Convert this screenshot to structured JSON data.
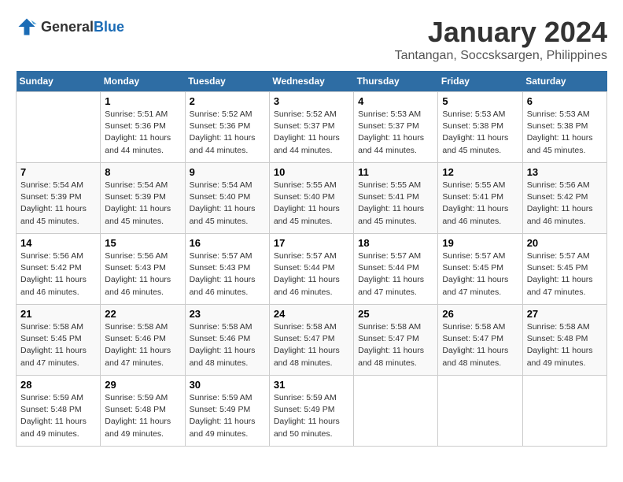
{
  "header": {
    "logo": {
      "general": "General",
      "blue": "Blue"
    },
    "title": "January 2024",
    "subtitle": "Tantangan, Soccsksargen, Philippines"
  },
  "calendar": {
    "days_of_week": [
      "Sunday",
      "Monday",
      "Tuesday",
      "Wednesday",
      "Thursday",
      "Friday",
      "Saturday"
    ],
    "weeks": [
      [
        {
          "day": "",
          "info": ""
        },
        {
          "day": "1",
          "info": "Sunrise: 5:51 AM\nSunset: 5:36 PM\nDaylight: 11 hours\nand 44 minutes."
        },
        {
          "day": "2",
          "info": "Sunrise: 5:52 AM\nSunset: 5:36 PM\nDaylight: 11 hours\nand 44 minutes."
        },
        {
          "day": "3",
          "info": "Sunrise: 5:52 AM\nSunset: 5:37 PM\nDaylight: 11 hours\nand 44 minutes."
        },
        {
          "day": "4",
          "info": "Sunrise: 5:53 AM\nSunset: 5:37 PM\nDaylight: 11 hours\nand 44 minutes."
        },
        {
          "day": "5",
          "info": "Sunrise: 5:53 AM\nSunset: 5:38 PM\nDaylight: 11 hours\nand 45 minutes."
        },
        {
          "day": "6",
          "info": "Sunrise: 5:53 AM\nSunset: 5:38 PM\nDaylight: 11 hours\nand 45 minutes."
        }
      ],
      [
        {
          "day": "7",
          "info": "Sunrise: 5:54 AM\nSunset: 5:39 PM\nDaylight: 11 hours\nand 45 minutes."
        },
        {
          "day": "8",
          "info": "Sunrise: 5:54 AM\nSunset: 5:39 PM\nDaylight: 11 hours\nand 45 minutes."
        },
        {
          "day": "9",
          "info": "Sunrise: 5:54 AM\nSunset: 5:40 PM\nDaylight: 11 hours\nand 45 minutes."
        },
        {
          "day": "10",
          "info": "Sunrise: 5:55 AM\nSunset: 5:40 PM\nDaylight: 11 hours\nand 45 minutes."
        },
        {
          "day": "11",
          "info": "Sunrise: 5:55 AM\nSunset: 5:41 PM\nDaylight: 11 hours\nand 45 minutes."
        },
        {
          "day": "12",
          "info": "Sunrise: 5:55 AM\nSunset: 5:41 PM\nDaylight: 11 hours\nand 46 minutes."
        },
        {
          "day": "13",
          "info": "Sunrise: 5:56 AM\nSunset: 5:42 PM\nDaylight: 11 hours\nand 46 minutes."
        }
      ],
      [
        {
          "day": "14",
          "info": "Sunrise: 5:56 AM\nSunset: 5:42 PM\nDaylight: 11 hours\nand 46 minutes."
        },
        {
          "day": "15",
          "info": "Sunrise: 5:56 AM\nSunset: 5:43 PM\nDaylight: 11 hours\nand 46 minutes."
        },
        {
          "day": "16",
          "info": "Sunrise: 5:57 AM\nSunset: 5:43 PM\nDaylight: 11 hours\nand 46 minutes."
        },
        {
          "day": "17",
          "info": "Sunrise: 5:57 AM\nSunset: 5:44 PM\nDaylight: 11 hours\nand 46 minutes."
        },
        {
          "day": "18",
          "info": "Sunrise: 5:57 AM\nSunset: 5:44 PM\nDaylight: 11 hours\nand 47 minutes."
        },
        {
          "day": "19",
          "info": "Sunrise: 5:57 AM\nSunset: 5:45 PM\nDaylight: 11 hours\nand 47 minutes."
        },
        {
          "day": "20",
          "info": "Sunrise: 5:57 AM\nSunset: 5:45 PM\nDaylight: 11 hours\nand 47 minutes."
        }
      ],
      [
        {
          "day": "21",
          "info": "Sunrise: 5:58 AM\nSunset: 5:45 PM\nDaylight: 11 hours\nand 47 minutes."
        },
        {
          "day": "22",
          "info": "Sunrise: 5:58 AM\nSunset: 5:46 PM\nDaylight: 11 hours\nand 47 minutes."
        },
        {
          "day": "23",
          "info": "Sunrise: 5:58 AM\nSunset: 5:46 PM\nDaylight: 11 hours\nand 48 minutes."
        },
        {
          "day": "24",
          "info": "Sunrise: 5:58 AM\nSunset: 5:47 PM\nDaylight: 11 hours\nand 48 minutes."
        },
        {
          "day": "25",
          "info": "Sunrise: 5:58 AM\nSunset: 5:47 PM\nDaylight: 11 hours\nand 48 minutes."
        },
        {
          "day": "26",
          "info": "Sunrise: 5:58 AM\nSunset: 5:47 PM\nDaylight: 11 hours\nand 48 minutes."
        },
        {
          "day": "27",
          "info": "Sunrise: 5:58 AM\nSunset: 5:48 PM\nDaylight: 11 hours\nand 49 minutes."
        }
      ],
      [
        {
          "day": "28",
          "info": "Sunrise: 5:59 AM\nSunset: 5:48 PM\nDaylight: 11 hours\nand 49 minutes."
        },
        {
          "day": "29",
          "info": "Sunrise: 5:59 AM\nSunset: 5:48 PM\nDaylight: 11 hours\nand 49 minutes."
        },
        {
          "day": "30",
          "info": "Sunrise: 5:59 AM\nSunset: 5:49 PM\nDaylight: 11 hours\nand 49 minutes."
        },
        {
          "day": "31",
          "info": "Sunrise: 5:59 AM\nSunset: 5:49 PM\nDaylight: 11 hours\nand 50 minutes."
        },
        {
          "day": "",
          "info": ""
        },
        {
          "day": "",
          "info": ""
        },
        {
          "day": "",
          "info": ""
        }
      ]
    ]
  }
}
